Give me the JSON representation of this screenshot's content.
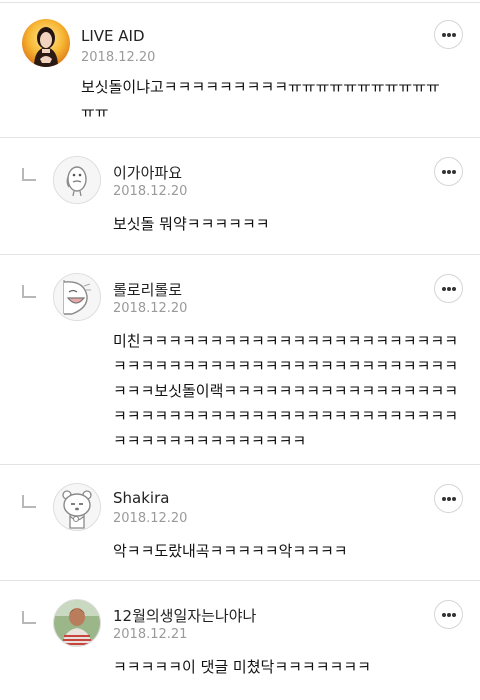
{
  "comments": [
    {
      "author": "LIVE AID",
      "date": "2018.12.20",
      "text": "보싯돌이냐고ㅋㅋㅋㅋㅋㅋㅋㅋㅋㅠㅠㅠㅠㅠㅠㅠㅠㅠㅠㅠㅠㅠ",
      "avatar_icon": "profile-photo-woman-icon"
    },
    {
      "author": "이가아파요",
      "date": "2018.12.20",
      "text": "보싯돌 뭐약ㅋㅋㅋㅋㅋㅋ",
      "avatar_icon": "cartoon-character-icon"
    },
    {
      "author": "롤로리롤로",
      "date": "2018.12.20",
      "text": "미친ㅋㅋㅋㅋㅋㅋㅋㅋㅋㅋㅋㅋㅋㅋㅋㅋㅋㅋㅋㅋㅋㅋㅋㅋㅋㅋㅋㅋㅋㅋㅋㅋㅋㅋㅋㅋㅋㅋㅋㅋㅋㅋㅋㅋㅋㅋㅋㅋㅋㅋㅋ보싯돌이랙ㅋㅋㅋㅋㅋㅋㅋㅋㅋㅋㅋㅋㅋㅋㅋㅋㅋㅋㅋㅋㅋㅋㅋㅋㅋㅋㅋㅋㅋㅋㅋㅋㅋㅋㅋㅋㅋㅋㅋㅋㅋㅋㅋㅋㅋㅋㅋㅋㅋㅋㅋㅋㅋㅋㅋㅋ",
      "avatar_icon": "laughing-character-icon"
    },
    {
      "author": "Shakira",
      "date": "2018.12.20",
      "text": "악ㅋㅋ도랐내곡ㅋㅋㅋㅋㅋ악ㅋㅋㅋㅋ",
      "avatar_icon": "cartoon-bear-icon"
    },
    {
      "author": "12월의생일자는나야나",
      "date": "2018.12.21",
      "text": "ㅋㅋㅋㅋㅋ이 댓글 미쳤닥ㅋㅋㅋㅋㅋㅋㅋ",
      "avatar_icon": "profile-photo-man-icon"
    }
  ],
  "colors": {
    "text": "#111111",
    "meta": "#9a9a9a",
    "divider": "#e3e3e3",
    "button_border": "#d6d6d6"
  }
}
